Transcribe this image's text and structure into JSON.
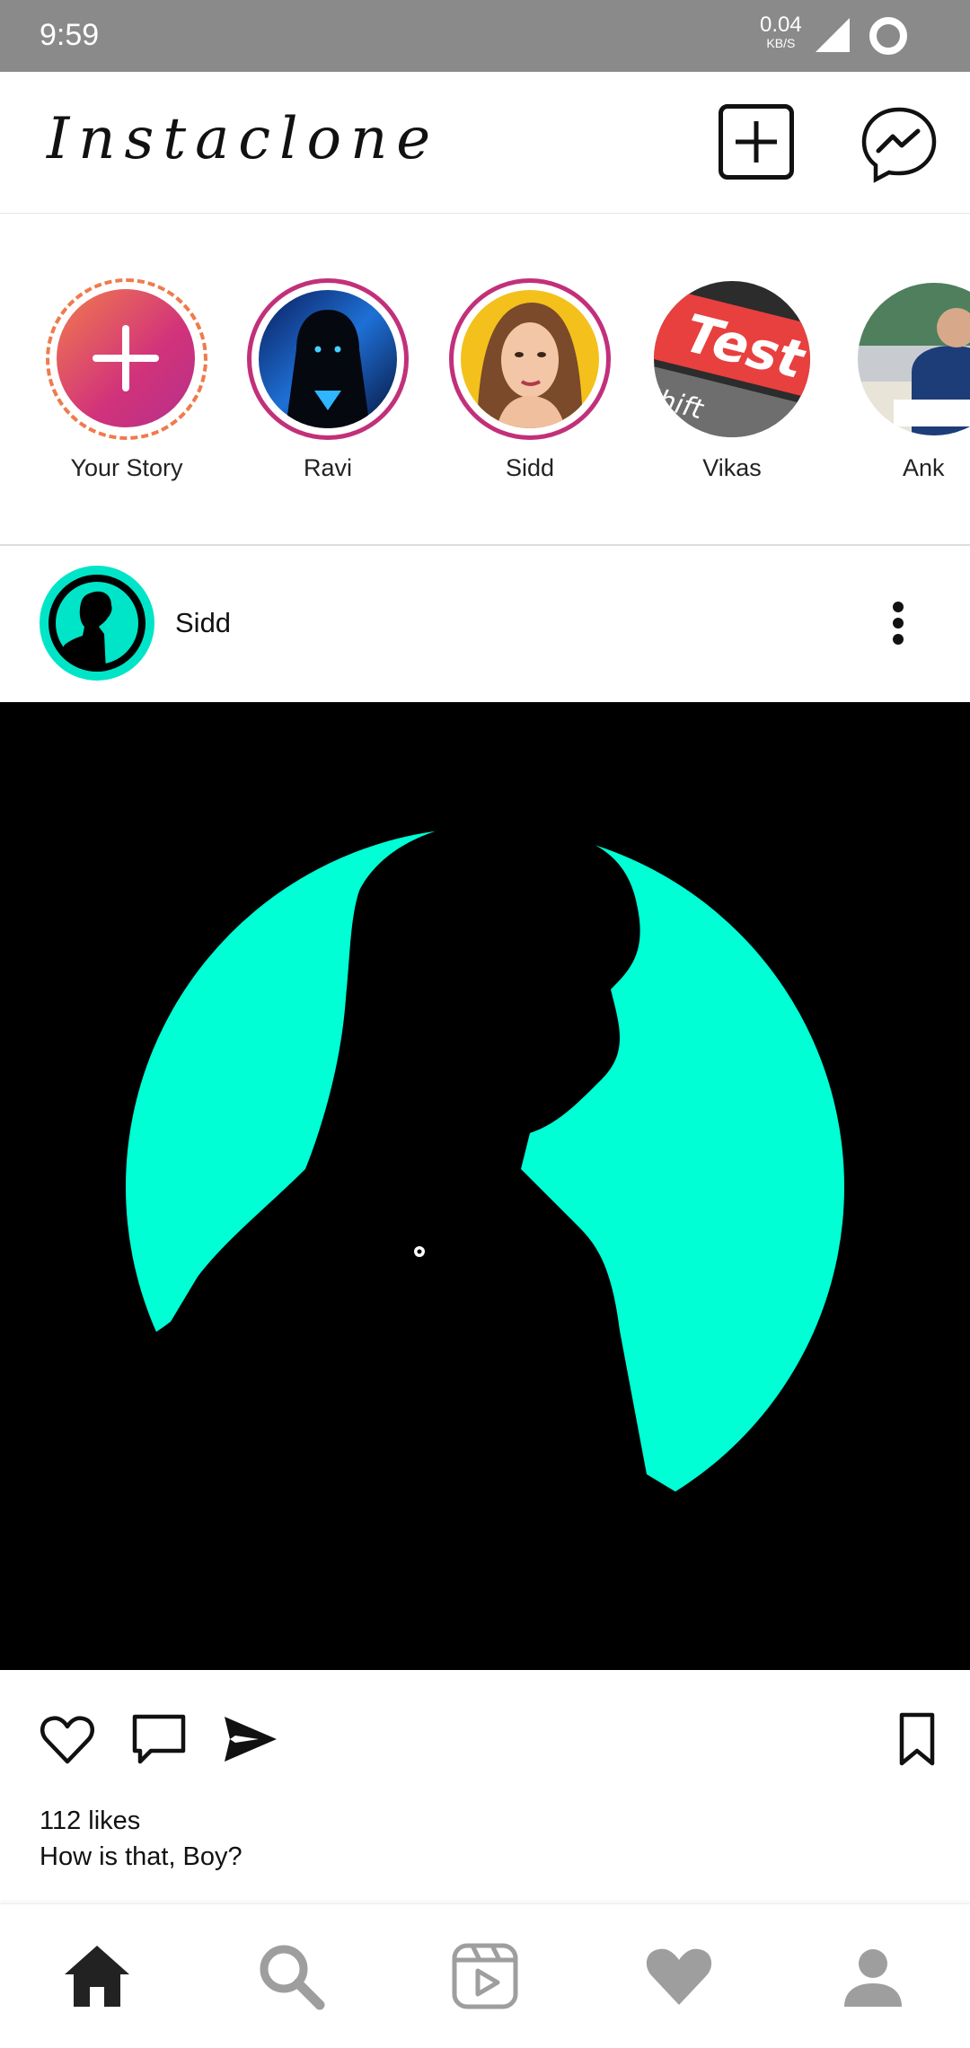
{
  "status_bar": {
    "time": "9:59",
    "speed_value": "0.04",
    "speed_unit": "KB/S"
  },
  "app_bar": {
    "title": "Instaclone",
    "new_post_icon": "plus-square-icon",
    "messenger_icon": "messenger-icon"
  },
  "stories": [
    {
      "name": "Your Story"
    },
    {
      "name": "Ravi"
    },
    {
      "name": "Sidd"
    },
    {
      "name": "Vikas"
    },
    {
      "name": "Ank"
    }
  ],
  "vikas_image_text": {
    "main": "Test",
    "sub": "Shift"
  },
  "post": {
    "username": "Sidd",
    "likes": "112 likes",
    "caption": "How is that, Boy?"
  },
  "colors": {
    "status_bar": "#8a8a8a",
    "story_ring": "#c2307a",
    "accent_teal": "#00ffd5",
    "nav_active": "#222222",
    "nav_inactive": "#9e9e9e"
  },
  "bottom_nav": [
    {
      "icon": "home-icon",
      "active": true
    },
    {
      "icon": "search-icon",
      "active": false
    },
    {
      "icon": "reels-icon",
      "active": false
    },
    {
      "icon": "heart-icon",
      "active": false
    },
    {
      "icon": "profile-icon",
      "active": false
    }
  ]
}
